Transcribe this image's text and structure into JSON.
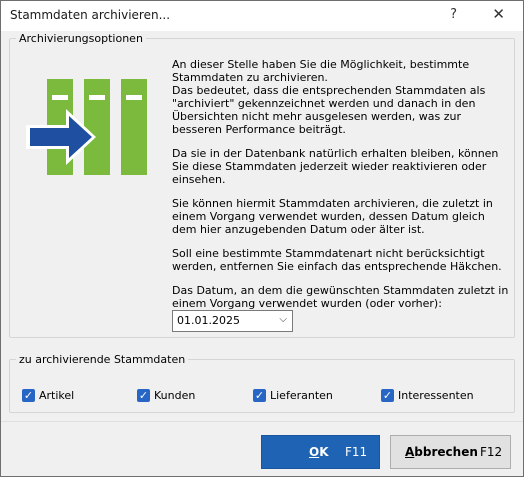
{
  "window": {
    "title": "Stammdaten archivieren...",
    "help_glyph": "?",
    "close_glyph": "✕"
  },
  "options": {
    "legend": "Archivierungsoptionen",
    "illustration": "archive-binders-with-arrow",
    "paragraphs": [
      "An dieser Stelle haben Sie die Möglichkeit, bestimmte Stammdaten zu archivieren.",
      "Das bedeutet, dass die entsprechenden Stammdaten als \"archiviert\" gekennzeichnet werden und danach in den Übersichten nicht mehr ausgelesen werden, was zur besseren Performance beiträgt.",
      "Da sie in der Datenbank natürlich erhalten bleiben, können Sie diese Stammdaten jederzeit wieder reaktivieren oder einsehen.",
      "Sie können hiermit Stammdaten archivieren, die zuletzt in einem Vorgang verwendet wurden, dessen Datum gleich dem hier anzugebenden Datum oder älter ist.",
      "Soll eine bestimmte Stammdatenart nicht berücksichtigt werden, entfernen Sie einfach das entsprechende Häkchen.",
      "Das Datum, an dem die gewünschten Stammdaten zuletzt in einem Vorgang verwendet wurden (oder vorher):"
    ],
    "date_value": "01.01.2025"
  },
  "masterdata": {
    "legend": "zu archivierende Stammdaten",
    "items": [
      {
        "label": "Artikel",
        "checked": true
      },
      {
        "label": "Kunden",
        "checked": true
      },
      {
        "label": "Lieferanten",
        "checked": true
      },
      {
        "label": "Interessenten",
        "checked": true
      }
    ]
  },
  "buttons": {
    "ok_mnemonic": "O",
    "ok_rest": "K",
    "ok_key": "F11",
    "cancel_mnemonic": "A",
    "cancel_rest": "bbrechen",
    "cancel_key": "F12"
  },
  "colors": {
    "binder_green": "#7cba3d",
    "arrow_blue": "#1f4fa0",
    "accent": "#1f63b4",
    "checkbox": "#2866c5"
  }
}
